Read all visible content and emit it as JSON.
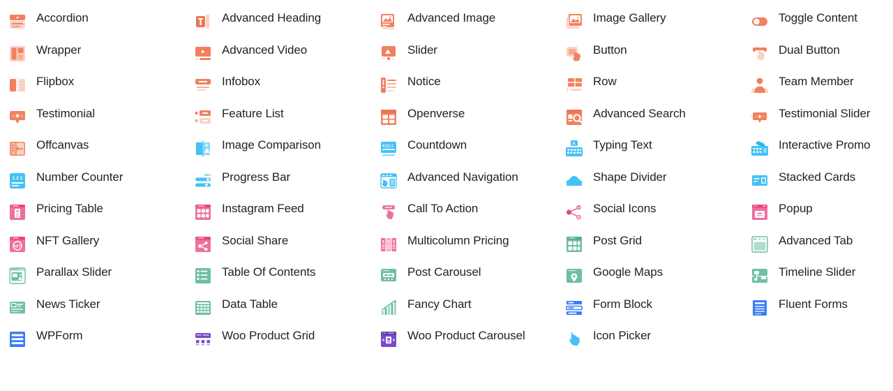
{
  "palette": {
    "coral_dark": "#ee7355",
    "coral": "#f2805f",
    "coral_light": "#f8ad92",
    "coral_pale": "#fbd2c3",
    "blue_dark": "#2fb6f2",
    "blue": "#45c1f5",
    "blue_light": "#8fd9fa",
    "pink_dark": "#e8447f",
    "pink": "#ef6f9f",
    "pink_light": "#f5a5c3",
    "green_dark": "#4fae8e",
    "green": "#6fbfa2",
    "green_light": "#a8d8c5",
    "royal_blue": "#3a7cf6",
    "purple": "#7b4bc9",
    "text": "#1f2124",
    "background": "#ffffff"
  },
  "grid": {
    "columns": 5,
    "rows": 11
  },
  "widgets": [
    [
      {
        "label": "Accordion",
        "icon": "accordion-icon",
        "color": "coral"
      },
      {
        "label": "Advanced Heading",
        "icon": "advanced-heading-icon",
        "color": "coral"
      },
      {
        "label": "Advanced Image",
        "icon": "advanced-image-icon",
        "color": "coral"
      },
      {
        "label": "Image Gallery",
        "icon": "image-gallery-icon",
        "color": "coral"
      },
      {
        "label": "Toggle Content",
        "icon": "toggle-content-icon",
        "color": "coral"
      }
    ],
    [
      {
        "label": "Wrapper",
        "icon": "wrapper-icon",
        "color": "coral"
      },
      {
        "label": "Advanced Video",
        "icon": "advanced-video-icon",
        "color": "coral"
      },
      {
        "label": "Slider",
        "icon": "slider-icon",
        "color": "coral"
      },
      {
        "label": "Button",
        "icon": "button-icon",
        "color": "coral"
      },
      {
        "label": "Dual Button",
        "icon": "dual-button-icon",
        "color": "coral"
      }
    ],
    [
      {
        "label": "Flipbox",
        "icon": "flipbox-icon",
        "color": "coral"
      },
      {
        "label": "Infobox",
        "icon": "infobox-icon",
        "color": "coral"
      },
      {
        "label": "Notice",
        "icon": "notice-icon",
        "color": "coral"
      },
      {
        "label": "Row",
        "icon": "row-icon",
        "color": "coral"
      },
      {
        "label": "Team Member",
        "icon": "team-member-icon",
        "color": "coral"
      }
    ],
    [
      {
        "label": "Testimonial",
        "icon": "testimonial-icon",
        "color": "coral"
      },
      {
        "label": "Feature List",
        "icon": "feature-list-icon",
        "color": "coral"
      },
      {
        "label": "Openverse",
        "icon": "openverse-icon",
        "color": "coral"
      },
      {
        "label": "Advanced Search",
        "icon": "advanced-search-icon",
        "color": "coral"
      },
      {
        "label": "Testimonial Slider",
        "icon": "testimonial-slider-icon",
        "color": "coral"
      }
    ],
    [
      {
        "label": "Offcanvas",
        "icon": "offcanvas-icon",
        "color": "coral"
      },
      {
        "label": "Image Comparison",
        "icon": "image-comparison-icon",
        "color": "blue"
      },
      {
        "label": "Countdown",
        "icon": "countdown-icon",
        "color": "blue"
      },
      {
        "label": "Typing Text",
        "icon": "typing-text-icon",
        "color": "blue"
      },
      {
        "label": "Interactive Promo",
        "icon": "interactive-promo-icon",
        "color": "blue"
      }
    ],
    [
      {
        "label": "Number Counter",
        "icon": "number-counter-icon",
        "color": "blue"
      },
      {
        "label": "Progress Bar",
        "icon": "progress-bar-icon",
        "color": "blue"
      },
      {
        "label": "Advanced Navigation",
        "icon": "advanced-navigation-icon",
        "color": "blue"
      },
      {
        "label": "Shape Divider",
        "icon": "shape-divider-icon",
        "color": "blue"
      },
      {
        "label": "Stacked Cards",
        "icon": "stacked-cards-icon",
        "color": "blue"
      }
    ],
    [
      {
        "label": "Pricing Table",
        "icon": "pricing-table-icon",
        "color": "pink"
      },
      {
        "label": "Instagram Feed",
        "icon": "instagram-feed-icon",
        "color": "pink"
      },
      {
        "label": "Call To Action",
        "icon": "call-to-action-icon",
        "color": "pink"
      },
      {
        "label": "Social Icons",
        "icon": "social-icons-icon",
        "color": "pink"
      },
      {
        "label": "Popup",
        "icon": "popup-icon",
        "color": "pink"
      }
    ],
    [
      {
        "label": "NFT Gallery",
        "icon": "nft-gallery-icon",
        "color": "pink"
      },
      {
        "label": "Social Share",
        "icon": "social-share-icon",
        "color": "pink"
      },
      {
        "label": "Multicolumn Pricing",
        "icon": "multicolumn-pricing-icon",
        "color": "pink"
      },
      {
        "label": "Post Grid",
        "icon": "post-grid-icon",
        "color": "green"
      },
      {
        "label": "Advanced Tab",
        "icon": "advanced-tab-icon",
        "color": "green"
      }
    ],
    [
      {
        "label": "Parallax Slider",
        "icon": "parallax-slider-icon",
        "color": "green"
      },
      {
        "label": "Table Of Contents",
        "icon": "table-of-contents-icon",
        "color": "green"
      },
      {
        "label": "Post Carousel",
        "icon": "post-carousel-icon",
        "color": "green"
      },
      {
        "label": "Google Maps",
        "icon": "google-maps-icon",
        "color": "green"
      },
      {
        "label": "Timeline Slider",
        "icon": "timeline-slider-icon",
        "color": "green"
      }
    ],
    [
      {
        "label": "News Ticker",
        "icon": "news-ticker-icon",
        "color": "green"
      },
      {
        "label": "Data Table",
        "icon": "data-table-icon",
        "color": "green"
      },
      {
        "label": "Fancy Chart",
        "icon": "fancy-chart-icon",
        "color": "green"
      },
      {
        "label": "Form Block",
        "icon": "form-block-icon",
        "color": "royal_blue"
      },
      {
        "label": "Fluent Forms",
        "icon": "fluent-forms-icon",
        "color": "royal_blue"
      }
    ],
    [
      {
        "label": "WPForm",
        "icon": "wpform-icon",
        "color": "royal_blue"
      },
      {
        "label": "Woo Product Grid",
        "icon": "woo-product-grid-icon",
        "color": "purple"
      },
      {
        "label": "Woo Product Carousel",
        "icon": "woo-product-carousel-icon",
        "color": "purple"
      },
      {
        "label": "Icon Picker",
        "icon": "icon-picker-icon",
        "color": "blue"
      },
      {
        "label": "",
        "icon": "",
        "color": ""
      }
    ]
  ]
}
